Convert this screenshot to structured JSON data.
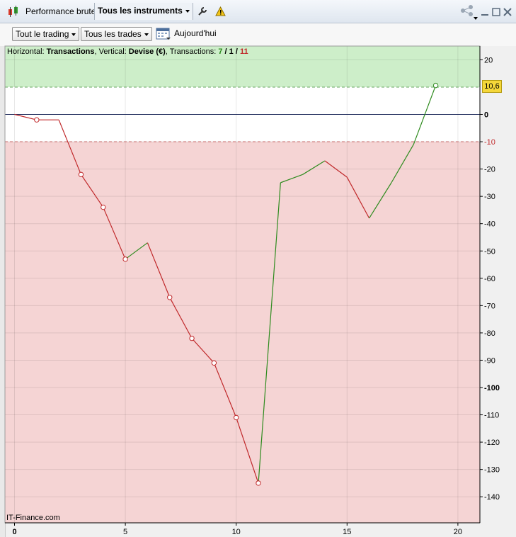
{
  "window": {
    "tab_title": "Performance brute",
    "instruments_dropdown": "Tous les instruments",
    "controls": [
      "share-icon",
      "minimize-icon",
      "maximize-icon",
      "close-icon"
    ]
  },
  "toolbar": {
    "trading_filter": "Tout le trading",
    "trades_filter": "Tous les trades",
    "today_label": "Aujourd'hui"
  },
  "info": {
    "horizontal_label": "Horizontal: ",
    "horizontal_value": "Transactions",
    "vertical_label": ", Vertical: ",
    "vertical_value": "Devise (€)",
    "transactions_label": ", Transactions: ",
    "transactions_win": "7",
    "sep1": " / ",
    "transactions_neutral": "1",
    "sep2": " / ",
    "transactions_loss": "11"
  },
  "credit": "IT-Finance.com",
  "last_value_tag": "10,6",
  "colors": {
    "profit_zone": "#cdeec9",
    "loss_zone": "#f5d4d4",
    "up_line": "#2e8b1e",
    "down_line": "#c0282a",
    "tag": "#f5d73a"
  },
  "chart_data": {
    "type": "line",
    "x": [
      0,
      1,
      2,
      3,
      4,
      5,
      6,
      7,
      8,
      9,
      10,
      11,
      12,
      13,
      14,
      15,
      16,
      17,
      18,
      19
    ],
    "y": [
      0,
      -2,
      -2,
      -22,
      -34,
      -53,
      -47,
      -67,
      -82,
      -91,
      -111,
      -135,
      -25,
      -22,
      -17,
      -23,
      -38,
      -25,
      -11,
      10.6
    ],
    "markers": [
      1,
      3,
      4,
      5,
      7,
      8,
      9,
      10,
      11,
      19
    ],
    "xticks": [
      0,
      5,
      10,
      15,
      20
    ],
    "yticks": [
      20,
      0,
      -10,
      -20,
      -30,
      -40,
      -50,
      -60,
      -70,
      -80,
      -90,
      -100,
      -110,
      -120,
      -130,
      -140
    ],
    "ytick_labels": [
      "20",
      "0",
      "-10",
      "-20",
      "-30",
      "-40",
      "-50",
      "-60",
      "-70",
      "-80",
      "-90",
      "-100",
      "-110",
      "-120",
      "-130",
      "-140"
    ],
    "bold_yticks": [
      0,
      -100
    ],
    "xlim": [
      0,
      21
    ],
    "ylim": [
      -150,
      30
    ],
    "upper_threshold": 10,
    "lower_threshold": -10,
    "grid": true
  }
}
